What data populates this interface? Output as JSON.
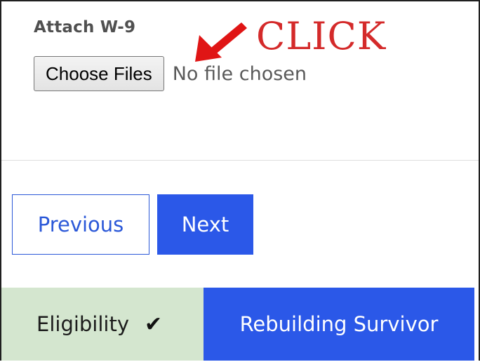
{
  "upload": {
    "label": "Attach W-9",
    "button_label": "Choose Files",
    "status_text": "No file chosen"
  },
  "annotation": {
    "text": "CLICK",
    "arrow_icon": "arrow-down-left-icon",
    "color": "#d42a2a"
  },
  "navigation": {
    "previous_label": "Previous",
    "next_label": "Next",
    "accent_color": "#2b58e8"
  },
  "steps": [
    {
      "label": "Eligibility",
      "status": "complete",
      "icon": "check-icon",
      "color": "#d4e6cf"
    },
    {
      "label": "Rebuilding Survivor",
      "status": "current",
      "color": "#2b58e8"
    }
  ]
}
